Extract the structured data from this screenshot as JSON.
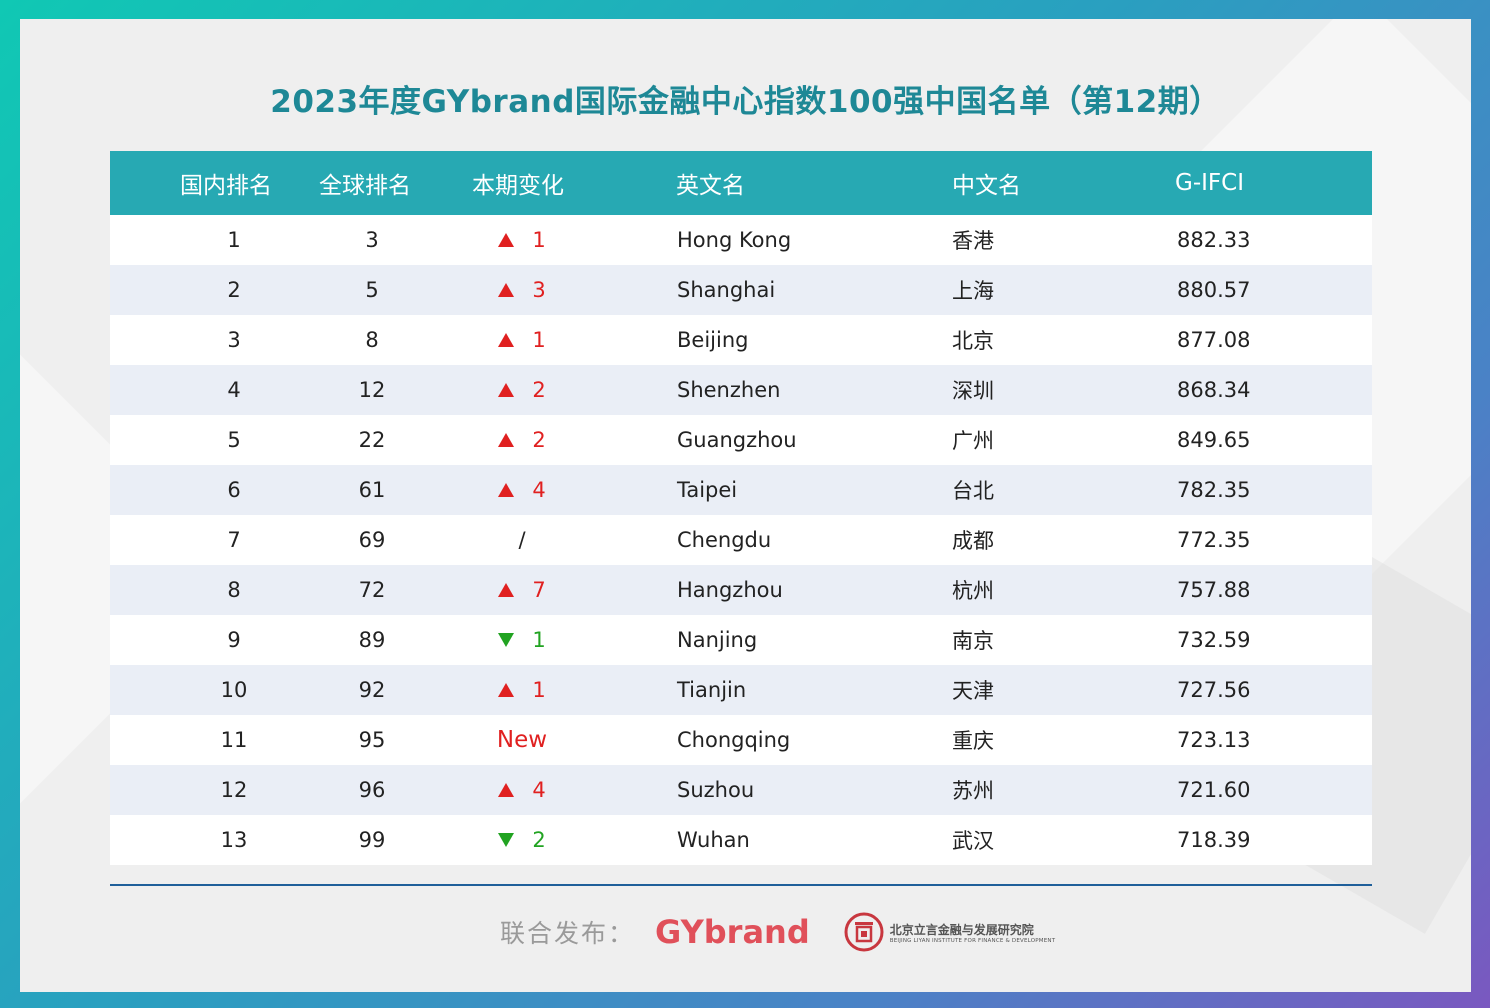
{
  "title": "2023年度GYbrand国际金融中心指数100强中国名单（第12期）",
  "headers": [
    "国内排名",
    "全球排名",
    "本期变化",
    "英文名",
    "中文名",
    "G-IFCI"
  ],
  "rows": [
    {
      "domestic": "1",
      "global": "3",
      "dir": "up",
      "change": "1",
      "en": "Hong Kong",
      "cn": "香港",
      "score": "882.33"
    },
    {
      "domestic": "2",
      "global": "5",
      "dir": "up",
      "change": "3",
      "en": "Shanghai",
      "cn": "上海",
      "score": "880.57"
    },
    {
      "domestic": "3",
      "global": "8",
      "dir": "up",
      "change": "1",
      "en": "Beijing",
      "cn": "北京",
      "score": "877.08"
    },
    {
      "domestic": "4",
      "global": "12",
      "dir": "up",
      "change": "2",
      "en": "Shenzhen",
      "cn": "深圳",
      "score": "868.34"
    },
    {
      "domestic": "5",
      "global": "22",
      "dir": "up",
      "change": "2",
      "en": "Guangzhou",
      "cn": "广州",
      "score": "849.65"
    },
    {
      "domestic": "6",
      "global": "61",
      "dir": "up",
      "change": "4",
      "en": "Taipei",
      "cn": "台北",
      "score": "782.35"
    },
    {
      "domestic": "7",
      "global": "69",
      "dir": "none",
      "change": "/",
      "en": "Chengdu",
      "cn": "成都",
      "score": "772.35"
    },
    {
      "domestic": "8",
      "global": "72",
      "dir": "up",
      "change": "7",
      "en": "Hangzhou",
      "cn": "杭州",
      "score": "757.88"
    },
    {
      "domestic": "9",
      "global": "89",
      "dir": "down",
      "change": "1",
      "en": "Nanjing",
      "cn": "南京",
      "score": "732.59"
    },
    {
      "domestic": "10",
      "global": "92",
      "dir": "up",
      "change": "1",
      "en": "Tianjin",
      "cn": "天津",
      "score": "727.56"
    },
    {
      "domestic": "11",
      "global": "95",
      "dir": "new",
      "change": "New",
      "en": "Chongqing",
      "cn": "重庆",
      "score": "723.13"
    },
    {
      "domestic": "12",
      "global": "96",
      "dir": "up",
      "change": "4",
      "en": "Suzhou",
      "cn": "苏州",
      "score": "721.60"
    },
    {
      "domestic": "13",
      "global": "99",
      "dir": "down",
      "change": "2",
      "en": "Wuhan",
      "cn": "武汉",
      "score": "718.39"
    }
  ],
  "footer": {
    "label": "联合发布：",
    "brand": "GYbrand",
    "institute_cn": "北京立言金融与发展研究院",
    "institute_en": "BEIJING LIYAN INSTITUTE FOR FINANCE & DEVELOPMENT"
  },
  "colors": {
    "header_bg": "#27a9b3",
    "title": "#1e8896",
    "up": "#e02020",
    "down": "#21a321",
    "brand": "#e0505a"
  }
}
